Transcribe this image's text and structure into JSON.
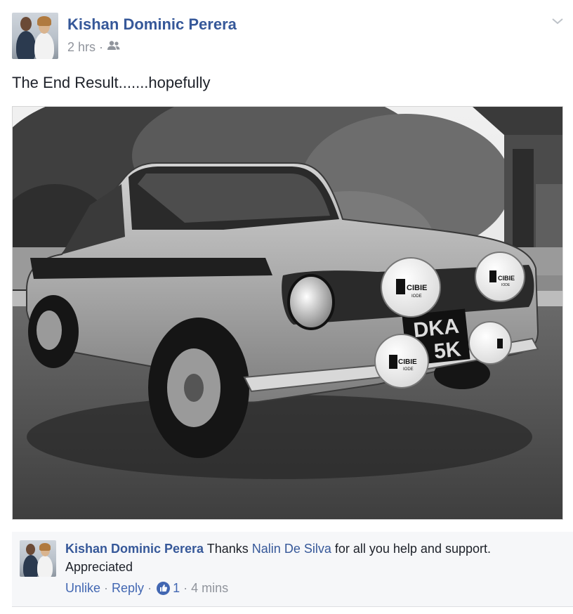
{
  "post": {
    "author": "Kishan Dominic Perera",
    "time": "2 hrs",
    "separator": "·",
    "audience_icon": "friends-icon",
    "text": "The End Result.......hopefully",
    "menu_icon": "chevron-down-icon",
    "photo": {
      "subject": "black and white photo of a vintage Ford Escort with Cibie spot lamps",
      "plate_text_line1": "DKA",
      "plate_text_line2": "5K",
      "lamp_text": "CIBIE",
      "lamp_subtext": "IODE"
    }
  },
  "comment": {
    "author": "Kishan Dominic Perera",
    "text_before_mention": " Thanks ",
    "mention": "Nalin De Silva",
    "text_after_mention": " for all you help and support. Appreciated",
    "actions": {
      "unlike": "Unlike",
      "reply": "Reply",
      "like_count": "1",
      "time": "4 mins",
      "separator": " · "
    },
    "like_icon": "thumbs-up-icon"
  },
  "colors": {
    "link": "#365899",
    "meta": "#90949c",
    "action": "#4267b2",
    "comment_bg": "#f6f7f9"
  }
}
